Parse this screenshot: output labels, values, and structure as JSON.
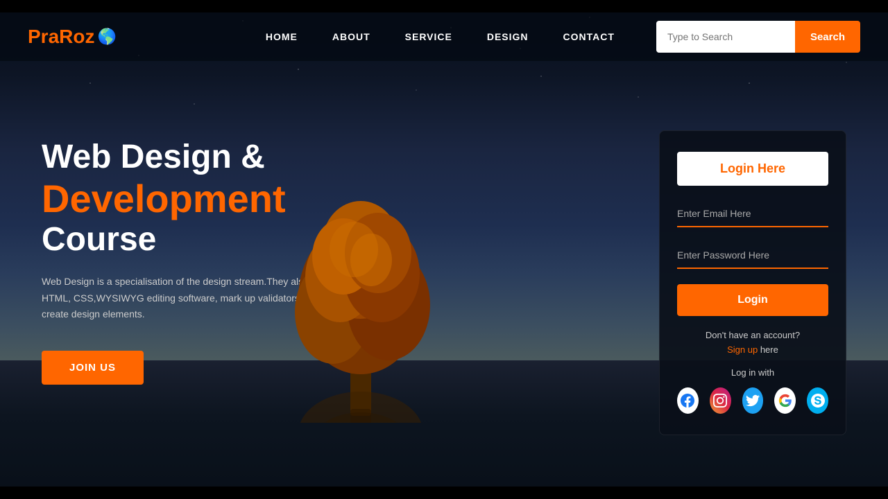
{
  "logo": {
    "text": "PraRoz",
    "globe_icon": "🌎"
  },
  "navbar": {
    "links": [
      {
        "label": "HOME",
        "id": "home"
      },
      {
        "label": "ABOUT",
        "id": "about"
      },
      {
        "label": "SERVICE",
        "id": "service"
      },
      {
        "label": "DESIGN",
        "id": "design"
      },
      {
        "label": "CONTACT",
        "id": "contact"
      }
    ],
    "search": {
      "placeholder": "Type to Search",
      "button_label": "Search"
    }
  },
  "hero": {
    "line1": "Web Design &",
    "line2": "Development",
    "line3": "Course",
    "description": "Web Design is a specialisation of the design stream.They also use HTML, CSS,WYSIWYG editing software, mark up validators etc., to create design elements.",
    "join_button": "JOIN US"
  },
  "login_card": {
    "header_button": "Login Here",
    "email_placeholder": "Enter Email Here",
    "password_placeholder": "Enter Password Here",
    "login_button": "Login",
    "no_account_text": "Don't have an account?",
    "signup_link": "Sign up",
    "signup_suffix": " here",
    "log_in_with": "Log in with",
    "social_icons": [
      {
        "name": "facebook-icon",
        "symbol": "f"
      },
      {
        "name": "instagram-icon",
        "symbol": "📷"
      },
      {
        "name": "twitter-icon",
        "symbol": "🐦"
      },
      {
        "name": "google-icon",
        "symbol": "G"
      },
      {
        "name": "skype-icon",
        "symbol": "S"
      }
    ]
  },
  "colors": {
    "accent": "#ff6600",
    "white": "#ffffff",
    "dark_bg": "#0a0e1a"
  }
}
